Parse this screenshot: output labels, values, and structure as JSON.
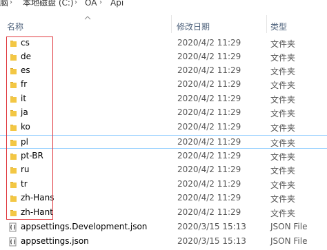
{
  "breadcrumb": {
    "items": [
      "脑",
      "本地磁盘 (C:)",
      "OA",
      "Api"
    ],
    "separator": "›"
  },
  "columns": {
    "name": "名称",
    "date": "修改日期",
    "type": "类型"
  },
  "rows": [
    {
      "name": "cs",
      "date": "2020/4/2 11:29",
      "type": "文件夹",
      "icon": "folder-icon"
    },
    {
      "name": "de",
      "date": "2020/4/2 11:29",
      "type": "文件夹",
      "icon": "folder-icon"
    },
    {
      "name": "es",
      "date": "2020/4/2 11:29",
      "type": "文件夹",
      "icon": "folder-icon"
    },
    {
      "name": "fr",
      "date": "2020/4/2 11:29",
      "type": "文件夹",
      "icon": "folder-icon"
    },
    {
      "name": "it",
      "date": "2020/4/2 11:29",
      "type": "文件夹",
      "icon": "folder-icon"
    },
    {
      "name": "ja",
      "date": "2020/4/2 11:29",
      "type": "文件夹",
      "icon": "folder-icon"
    },
    {
      "name": "ko",
      "date": "2020/4/2 11:29",
      "type": "文件夹",
      "icon": "folder-icon"
    },
    {
      "name": "pl",
      "date": "2020/4/2 11:29",
      "type": "文件夹",
      "icon": "folder-icon",
      "selected": true
    },
    {
      "name": "pt-BR",
      "date": "2020/4/2 11:29",
      "type": "文件夹",
      "icon": "folder-icon"
    },
    {
      "name": "ru",
      "date": "2020/4/2 11:29",
      "type": "文件夹",
      "icon": "folder-icon"
    },
    {
      "name": "tr",
      "date": "2020/4/2 11:29",
      "type": "文件夹",
      "icon": "folder-icon"
    },
    {
      "name": "zh-Hans",
      "date": "2020/4/2 11:29",
      "type": "文件夹",
      "icon": "folder-icon"
    },
    {
      "name": "zh-Hant",
      "date": "2020/4/2 11:29",
      "type": "文件夹",
      "icon": "folder-icon"
    },
    {
      "name": "appsettings.Development.json",
      "date": "2020/3/15 15:13",
      "type": "JSON File",
      "icon": "json-file-icon"
    },
    {
      "name": "appsettings.json",
      "date": "2020/3/15 15:13",
      "type": "JSON File",
      "icon": "json-file-icon"
    }
  ],
  "colors": {
    "folder": "#f3c744",
    "folder_dark": "#d9a62c",
    "selection_border": "#99d1ff",
    "highlight_box": "#e0383e",
    "header_text": "#4c607a"
  }
}
